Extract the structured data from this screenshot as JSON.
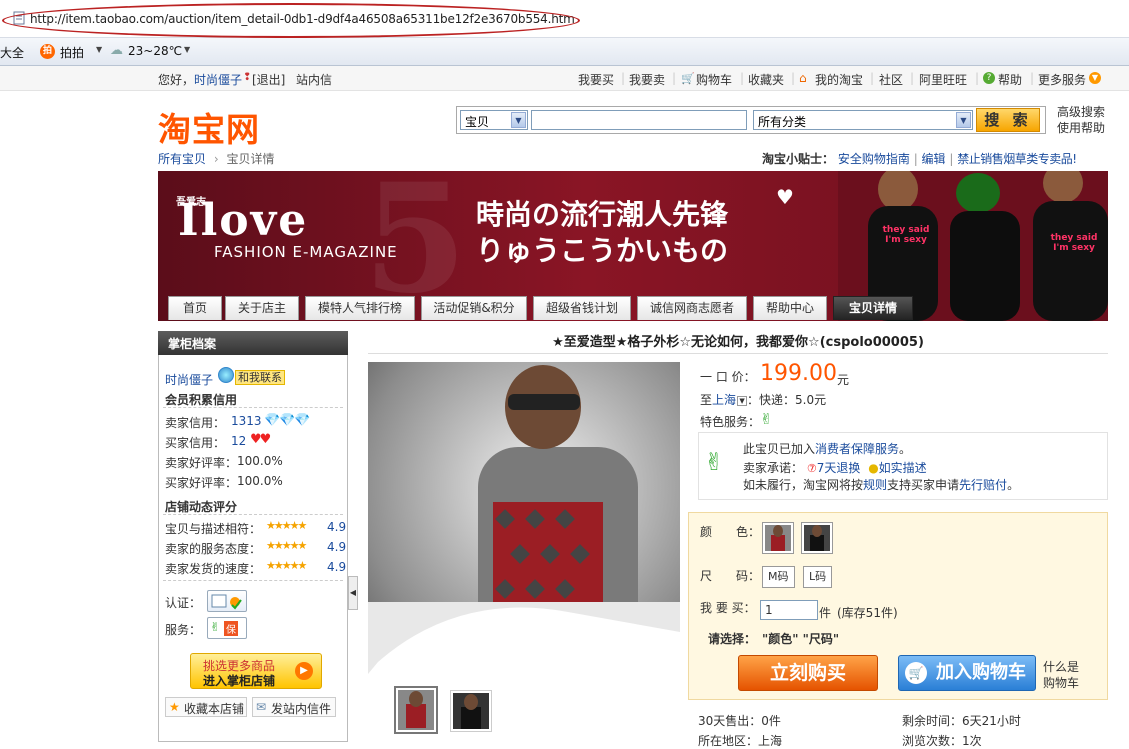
{
  "browser": {
    "url": "http://item.taobao.com/auction/item_detail-0db1-d9df4a46508a65311be12f2e3670b554.htm",
    "fav_items": [
      "大全",
      "拍拍",
      "23~28℃"
    ]
  },
  "topbar": {
    "greeting": "您好，",
    "username": "时尚僵子",
    "logout": "[退出]",
    "messages": "站内信",
    "links": [
      "我要买",
      "我要卖",
      "购物车",
      "收藏夹",
      "我的淘宝",
      "社区",
      "阿里旺旺",
      "帮助",
      "更多服务"
    ]
  },
  "header": {
    "logo": "淘宝网",
    "search_category": "宝贝",
    "search_value": "",
    "category_select": "所有分类",
    "search_button": "搜 索",
    "advanced_search": "高级搜索",
    "help": "使用帮助"
  },
  "breadcrumb": {
    "root": "所有宝贝",
    "current": "宝贝详情"
  },
  "tips": {
    "label": "淘宝小贴士：",
    "links": [
      "安全购物指南",
      "编辑",
      "禁止销售烟草类专卖品!"
    ]
  },
  "banner": {
    "brand_small": "吾爱志",
    "brand": "Ilove",
    "subtitle": "FASHION E-MAGAZINE",
    "number": "5",
    "slogan1": "時尚の流行潮人先锋",
    "slogan2": "りゅうこうかいもの",
    "shirt_text": "they said I'm sexy",
    "tabs": [
      "首页",
      "关于店主",
      "模特人气排行榜",
      "活动促销&积分",
      "超级省钱计划",
      "诚信网商志愿者",
      "帮助中心",
      "宝贝详情"
    ]
  },
  "seller": {
    "panel_title": "掌柜档案",
    "name": "时尚僵子",
    "contact": "和我联系",
    "credit_title": "会员积累信用",
    "seller_credit_label": "卖家信用：",
    "seller_credit_value": "1313",
    "buyer_credit_label": "买家信用：",
    "buyer_credit_value": "12",
    "seller_rate_label": "卖家好评率：",
    "seller_rate": "100.0%",
    "buyer_rate_label": "买家好评率：",
    "buyer_rate": "100.0%",
    "dsr_title": "店铺动态评分",
    "dsr": [
      {
        "label": "宝贝与描述相符：",
        "score": "4.9"
      },
      {
        "label": "卖家的服务态度：",
        "score": "4.9"
      },
      {
        "label": "卖家发货的速度：",
        "score": "4.9"
      }
    ],
    "cert_label": "认证：",
    "service_label": "服务：",
    "service_badge": "保",
    "shop_button_line1": "挑选更多商品",
    "shop_button_line2": "进入掌柜店铺",
    "fav_shop": "收藏本店铺",
    "send_msg": "发站内信件"
  },
  "product": {
    "title": "★至爱造型★格子外杉☆无论如何，我都爱你☆(cspolo00005)",
    "price_label": "一 口 价：",
    "price": "199.00",
    "currency": "元",
    "ship_prefix": "至",
    "ship_city": "上海",
    "ship_text": "：快递：5.0元",
    "feature_label": "特色服务：",
    "guarantee_text1": "此宝贝已加入",
    "guarantee_link": "消费者保障服务",
    "guarantee_text2": "。",
    "promise_label": "卖家承诺：",
    "promise1": "7天退换",
    "promise2": "如实描述",
    "fail_text1": "如未履行，淘宝网将按",
    "fail_link1": "规则",
    "fail_text2": "支持买家申请",
    "fail_link2": "先行赔付",
    "fail_text3": "。",
    "color_label": "颜　　色：",
    "size_label": "尺　　码：",
    "sizes": [
      "M码",
      "L码"
    ],
    "qty_label": "我 要 买：",
    "qty_value": "1",
    "qty_unit": "件",
    "stock": "(库存51件)",
    "choose_label": "请选择：",
    "choose_value": "\"颜色\" \"尺码\"",
    "buy_button": "立刻购买",
    "cart_button": "加入购物车",
    "what_is_cart1": "什么是",
    "what_is_cart2": "购物车",
    "sold_label": "30天售出：",
    "sold_value": "0件",
    "remaining_label": "剩余时间：",
    "remaining_value": "6天21小时",
    "location_label": "所在地区：",
    "location_value": "上海",
    "views_label": "浏览次数：",
    "views_value": "1次"
  },
  "colors": {
    "brand_orange": "#ff5500",
    "banner_red": "#8a1525",
    "link_blue": "#1a4b9c"
  }
}
